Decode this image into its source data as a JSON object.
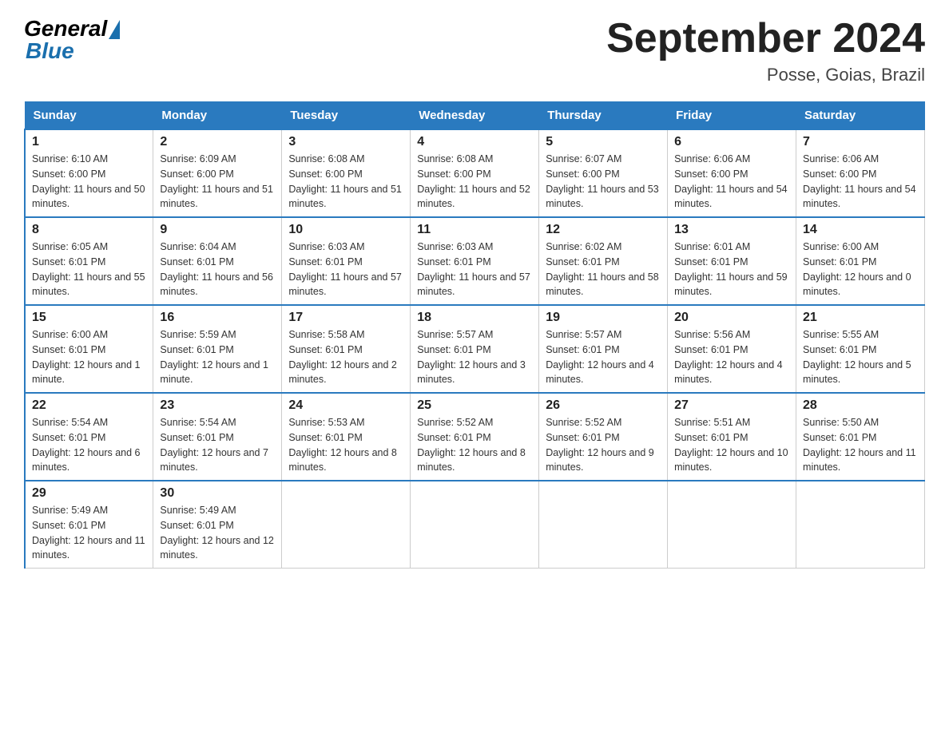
{
  "header": {
    "logo_general": "General",
    "logo_blue": "Blue",
    "month_title": "September 2024",
    "location": "Posse, Goias, Brazil"
  },
  "days_of_week": [
    "Sunday",
    "Monday",
    "Tuesday",
    "Wednesday",
    "Thursday",
    "Friday",
    "Saturday"
  ],
  "weeks": [
    [
      {
        "day": "1",
        "sunrise": "Sunrise: 6:10 AM",
        "sunset": "Sunset: 6:00 PM",
        "daylight": "Daylight: 11 hours and 50 minutes."
      },
      {
        "day": "2",
        "sunrise": "Sunrise: 6:09 AM",
        "sunset": "Sunset: 6:00 PM",
        "daylight": "Daylight: 11 hours and 51 minutes."
      },
      {
        "day": "3",
        "sunrise": "Sunrise: 6:08 AM",
        "sunset": "Sunset: 6:00 PM",
        "daylight": "Daylight: 11 hours and 51 minutes."
      },
      {
        "day": "4",
        "sunrise": "Sunrise: 6:08 AM",
        "sunset": "Sunset: 6:00 PM",
        "daylight": "Daylight: 11 hours and 52 minutes."
      },
      {
        "day": "5",
        "sunrise": "Sunrise: 6:07 AM",
        "sunset": "Sunset: 6:00 PM",
        "daylight": "Daylight: 11 hours and 53 minutes."
      },
      {
        "day": "6",
        "sunrise": "Sunrise: 6:06 AM",
        "sunset": "Sunset: 6:00 PM",
        "daylight": "Daylight: 11 hours and 54 minutes."
      },
      {
        "day": "7",
        "sunrise": "Sunrise: 6:06 AM",
        "sunset": "Sunset: 6:00 PM",
        "daylight": "Daylight: 11 hours and 54 minutes."
      }
    ],
    [
      {
        "day": "8",
        "sunrise": "Sunrise: 6:05 AM",
        "sunset": "Sunset: 6:01 PM",
        "daylight": "Daylight: 11 hours and 55 minutes."
      },
      {
        "day": "9",
        "sunrise": "Sunrise: 6:04 AM",
        "sunset": "Sunset: 6:01 PM",
        "daylight": "Daylight: 11 hours and 56 minutes."
      },
      {
        "day": "10",
        "sunrise": "Sunrise: 6:03 AM",
        "sunset": "Sunset: 6:01 PM",
        "daylight": "Daylight: 11 hours and 57 minutes."
      },
      {
        "day": "11",
        "sunrise": "Sunrise: 6:03 AM",
        "sunset": "Sunset: 6:01 PM",
        "daylight": "Daylight: 11 hours and 57 minutes."
      },
      {
        "day": "12",
        "sunrise": "Sunrise: 6:02 AM",
        "sunset": "Sunset: 6:01 PM",
        "daylight": "Daylight: 11 hours and 58 minutes."
      },
      {
        "day": "13",
        "sunrise": "Sunrise: 6:01 AM",
        "sunset": "Sunset: 6:01 PM",
        "daylight": "Daylight: 11 hours and 59 minutes."
      },
      {
        "day": "14",
        "sunrise": "Sunrise: 6:00 AM",
        "sunset": "Sunset: 6:01 PM",
        "daylight": "Daylight: 12 hours and 0 minutes."
      }
    ],
    [
      {
        "day": "15",
        "sunrise": "Sunrise: 6:00 AM",
        "sunset": "Sunset: 6:01 PM",
        "daylight": "Daylight: 12 hours and 1 minute."
      },
      {
        "day": "16",
        "sunrise": "Sunrise: 5:59 AM",
        "sunset": "Sunset: 6:01 PM",
        "daylight": "Daylight: 12 hours and 1 minute."
      },
      {
        "day": "17",
        "sunrise": "Sunrise: 5:58 AM",
        "sunset": "Sunset: 6:01 PM",
        "daylight": "Daylight: 12 hours and 2 minutes."
      },
      {
        "day": "18",
        "sunrise": "Sunrise: 5:57 AM",
        "sunset": "Sunset: 6:01 PM",
        "daylight": "Daylight: 12 hours and 3 minutes."
      },
      {
        "day": "19",
        "sunrise": "Sunrise: 5:57 AM",
        "sunset": "Sunset: 6:01 PM",
        "daylight": "Daylight: 12 hours and 4 minutes."
      },
      {
        "day": "20",
        "sunrise": "Sunrise: 5:56 AM",
        "sunset": "Sunset: 6:01 PM",
        "daylight": "Daylight: 12 hours and 4 minutes."
      },
      {
        "day": "21",
        "sunrise": "Sunrise: 5:55 AM",
        "sunset": "Sunset: 6:01 PM",
        "daylight": "Daylight: 12 hours and 5 minutes."
      }
    ],
    [
      {
        "day": "22",
        "sunrise": "Sunrise: 5:54 AM",
        "sunset": "Sunset: 6:01 PM",
        "daylight": "Daylight: 12 hours and 6 minutes."
      },
      {
        "day": "23",
        "sunrise": "Sunrise: 5:54 AM",
        "sunset": "Sunset: 6:01 PM",
        "daylight": "Daylight: 12 hours and 7 minutes."
      },
      {
        "day": "24",
        "sunrise": "Sunrise: 5:53 AM",
        "sunset": "Sunset: 6:01 PM",
        "daylight": "Daylight: 12 hours and 8 minutes."
      },
      {
        "day": "25",
        "sunrise": "Sunrise: 5:52 AM",
        "sunset": "Sunset: 6:01 PM",
        "daylight": "Daylight: 12 hours and 8 minutes."
      },
      {
        "day": "26",
        "sunrise": "Sunrise: 5:52 AM",
        "sunset": "Sunset: 6:01 PM",
        "daylight": "Daylight: 12 hours and 9 minutes."
      },
      {
        "day": "27",
        "sunrise": "Sunrise: 5:51 AM",
        "sunset": "Sunset: 6:01 PM",
        "daylight": "Daylight: 12 hours and 10 minutes."
      },
      {
        "day": "28",
        "sunrise": "Sunrise: 5:50 AM",
        "sunset": "Sunset: 6:01 PM",
        "daylight": "Daylight: 12 hours and 11 minutes."
      }
    ],
    [
      {
        "day": "29",
        "sunrise": "Sunrise: 5:49 AM",
        "sunset": "Sunset: 6:01 PM",
        "daylight": "Daylight: 12 hours and 11 minutes."
      },
      {
        "day": "30",
        "sunrise": "Sunrise: 5:49 AM",
        "sunset": "Sunset: 6:01 PM",
        "daylight": "Daylight: 12 hours and 12 minutes."
      },
      null,
      null,
      null,
      null,
      null
    ]
  ]
}
